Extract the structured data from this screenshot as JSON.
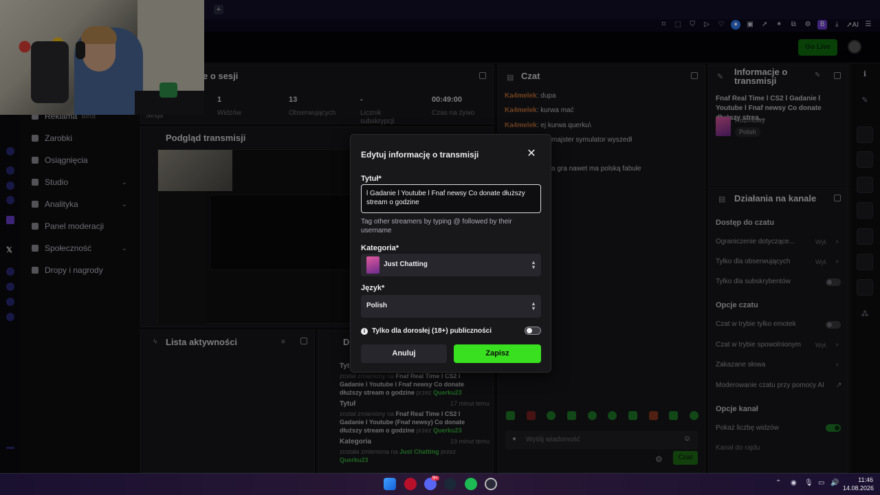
{
  "extensions": [
    "B",
    "AI"
  ],
  "header": {
    "go_live": "Go Live"
  },
  "sidebar": {
    "items": [
      {
        "label": "Reklama",
        "badge": "Beta"
      },
      {
        "label": "Zarobki"
      },
      {
        "label": "Osiągnięcia"
      },
      {
        "label": "Studio"
      },
      {
        "label": "Analityka"
      },
      {
        "label": "Panel moderacji"
      },
      {
        "label": "Społeczność"
      },
      {
        "label": "Dropy i nagrody"
      }
    ]
  },
  "session": {
    "title": "e o sesji",
    "stats": [
      {
        "value": "1",
        "label": "Widzów"
      },
      {
        "value": "13",
        "label": "Obserwujących"
      },
      {
        "value": "-",
        "label": "Licznik subskrypcji"
      },
      {
        "value": "00:49:00",
        "label": "Czas na żywo"
      }
    ],
    "sesja": "Sesja"
  },
  "preview": {
    "title": "Podgląd transmisji"
  },
  "activity": {
    "title": "Lista aktywności",
    "d_title": "D",
    "events": [
      {
        "heading": "Tytu",
        "text_prefix": "został zmieniony na",
        "text_bold": "Fnaf Real Time l CS2 l Gadanie l Youtube l Fnaf newsy Co donate dłuższy stream o godzine",
        "by": "przez",
        "user": "Querku23",
        "time": ""
      },
      {
        "heading": "Tytuł",
        "text_prefix": "został zmieniony na",
        "text_bold": "Fnaf Real Time l CS2 l Gadanie l Youtube (Fnaf newsy) Co donate dłuższy stream o godzine",
        "by": "przez",
        "user": "Querku23",
        "time": "17 minut temu"
      },
      {
        "heading": "Kategoria",
        "text_prefix": "została zmieniona na",
        "text_bold": "Just Chatting",
        "by": "przez",
        "user": "Querku23",
        "time": "19 minut temu"
      }
    ]
  },
  "chat": {
    "title": "Czat",
    "messages": [
      {
        "user": "Ka4melek",
        "text": ": dupa"
      },
      {
        "user": "Ka4melek",
        "text": ": kurwa mać"
      },
      {
        "user": "Ka4melek",
        "text": ": ej kurwa querku\\"
      },
      {
        "user": "",
        "text": "majster symulator wyszedł"
      },
      {
        "user": "",
        "text": "a gra nawet ma polską fabułe"
      }
    ],
    "input_placeholder": "Wyślij wiadomość",
    "send_label": "Czat"
  },
  "info_panel": {
    "title": "Informacje o transmisji",
    "stream_title": "Fnaf Real Time l CS2 l Gadanie l Youtube l Fnaf newsy Co donate dłuższy strea...",
    "category": "Rozmowy",
    "tag": "Polish"
  },
  "channel_actions": {
    "title": "Działania na kanale",
    "sections": {
      "chat_access": "Dostęp do czatu",
      "chat_options": "Opcje czatu",
      "channel_options": "Opcje kanał"
    },
    "rows": {
      "restriction": "Ograniczenie dotyczące...",
      "restriction_value": "Wył.",
      "followers": "Tylko dla obserwujących",
      "followers_value": "Wył.",
      "subscribers": "Tylko dla subskrybentów",
      "emote": "Czat w trybie tylko emotek",
      "slow": "Czat w trybie spowolnionym",
      "slow_value": "Wył.",
      "banned": "Zakazane słowa",
      "ai_mod": "Moderowanie czatu przy pomocy AI",
      "viewer_count": "Pokaż liczbę widzów",
      "raid": "Kanał do rajdu"
    }
  },
  "modal": {
    "title": "Edytuj informację o transmisji",
    "title_label": "Tytuł*",
    "title_value": "l Gadanie l Youtube l Fnaf newsy Co donate dłuższy stream o godzine",
    "help": "Tag other streamers by typing @ followed by their username",
    "category_label": "Kategoria*",
    "category_value": "Just Chatting",
    "language_label": "Język*",
    "language_value": "Polish",
    "adult_label": "Tylko dla dorosłej (18+) publiczności",
    "adult_enabled": false,
    "cancel_label": "Anuluj",
    "save_label": "Zapisz",
    "save_color": "#39e01f"
  },
  "taskbar": {
    "time": "11:46",
    "date": "14.08.2026",
    "badge_count": "9+"
  }
}
